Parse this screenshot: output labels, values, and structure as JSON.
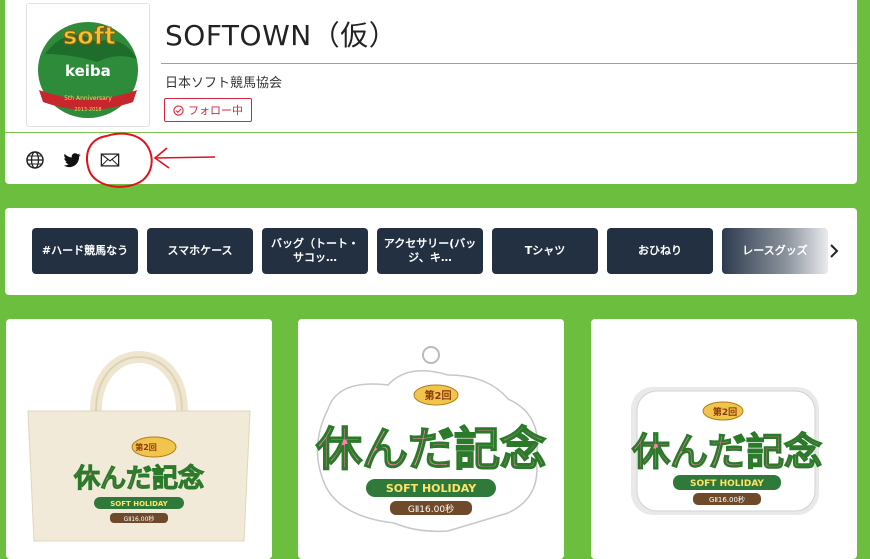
{
  "shop": {
    "title": "SOFTOWN（仮）",
    "owner": "日本ソフト競馬協会",
    "follow_label": "フォロー中",
    "logo": {
      "text_top": "soft",
      "text_mid": "keiba",
      "banner_text": "5th Anniversary",
      "years": "2013-2018"
    }
  },
  "social": {
    "icons": [
      "globe-icon",
      "twitter-icon",
      "mail-icon"
    ]
  },
  "categories": {
    "items": [
      {
        "label": "#ハード競馬なう"
      },
      {
        "label": "スマホケース"
      },
      {
        "label": "バッグ（トート・サコッ…"
      },
      {
        "label": "アクセサリー(バッジ、キ…"
      },
      {
        "label": "Tシャツ"
      },
      {
        "label": "おひねり"
      },
      {
        "label": "レースグッズ"
      }
    ],
    "next_icon": "chevron-right-icon"
  },
  "products": [
    {
      "type": "tote-bag",
      "badge": "第2回",
      "title": "休んだ記念",
      "subtitle": "SOFT HOLIDAY",
      "grade": "GⅡ16.00秒"
    },
    {
      "type": "acrylic-keychain",
      "badge": "第2回",
      "title": "休んだ記念",
      "subtitle": "SOFT HOLIDAY",
      "grade": "GⅡ16.00秒"
    },
    {
      "type": "button-badge",
      "badge": "第2回",
      "title": "休んだ記念",
      "subtitle": "SOFT HOLIDAY",
      "grade": "GⅡ16.00秒"
    }
  ],
  "colors": {
    "page_background": "#6cbf3e",
    "category_button": "#233042",
    "follow_accent": "#d7263d",
    "annotation_red": "#e0121a"
  }
}
